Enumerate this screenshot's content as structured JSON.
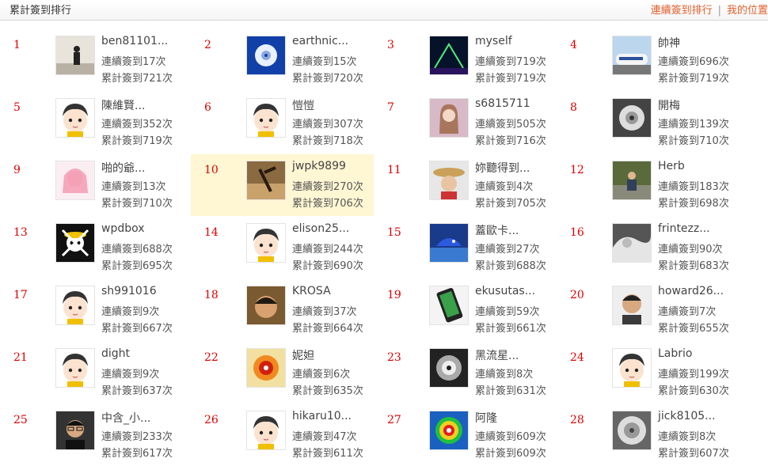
{
  "header": {
    "title": "累計簽到排行",
    "links": {
      "consecutive": "連續簽到排行",
      "separator": "|",
      "my_position": "我的位置"
    }
  },
  "rows": [
    {
      "rank": "1",
      "name": "ben81101...",
      "streak": "連續簽到17次",
      "total": "累計簽到721次",
      "avatar_icon": "silhouette-icon",
      "highlight": false
    },
    {
      "rank": "2",
      "name": "earthnic...",
      "streak": "連續簽到15次",
      "total": "累計簽到720次",
      "avatar_icon": "typhoon-satellite-icon",
      "highlight": false
    },
    {
      "rank": "3",
      "name": "myself",
      "streak": "連續簽到719次",
      "total": "累計簽到719次",
      "avatar_icon": "night-bridge-icon",
      "highlight": false
    },
    {
      "rank": "4",
      "name": "帥神",
      "streak": "連續簽到696次",
      "total": "累計簽到719次",
      "avatar_icon": "train-icon",
      "highlight": false
    },
    {
      "rank": "5",
      "name": "陳維賢...",
      "streak": "連續簽到352次",
      "total": "累計簽到719次",
      "avatar_icon": "default-avatar-icon",
      "highlight": false
    },
    {
      "rank": "6",
      "name": "愷愷",
      "streak": "連續簽到307次",
      "total": "累計簽到718次",
      "avatar_icon": "default-avatar-icon",
      "highlight": false
    },
    {
      "rank": "7",
      "name": "s6815711",
      "streak": "連續簽到505次",
      "total": "累計簽到716次",
      "avatar_icon": "portrait-woman-icon",
      "highlight": false
    },
    {
      "rank": "8",
      "name": "開梅",
      "streak": "連續簽到139次",
      "total": "累計簽到710次",
      "avatar_icon": "typhoon-gray-icon",
      "highlight": false
    },
    {
      "rank": "9",
      "name": "啪的爺...",
      "streak": "連續簽到13次",
      "total": "累計簽到710次",
      "avatar_icon": "anime-girl-icon",
      "highlight": false
    },
    {
      "rank": "10",
      "name": "jwpk9899",
      "streak": "連續簽到270次",
      "total": "累計簽到706次",
      "avatar_icon": "warrior-art-icon",
      "highlight": true
    },
    {
      "rank": "11",
      "name": "妳聽得到...",
      "streak": "連續簽到4次",
      "total": "累計簽到705次",
      "avatar_icon": "straw-hat-icon",
      "highlight": false
    },
    {
      "rank": "12",
      "name": "Herb",
      "streak": "連續簽到183次",
      "total": "累計簽到698次",
      "avatar_icon": "man-sitting-icon",
      "highlight": false
    },
    {
      "rank": "13",
      "name": "wpdbox",
      "streak": "連續簽到688次",
      "total": "累計簽到695次",
      "avatar_icon": "pirate-skull-icon",
      "highlight": false
    },
    {
      "rank": "14",
      "name": "elison25...",
      "streak": "連續簽到244次",
      "total": "累計簽到690次",
      "avatar_icon": "default-avatar-icon",
      "highlight": false
    },
    {
      "rank": "15",
      "name": "蓋歐卡...",
      "streak": "連續簽到27次",
      "total": "累計簽到688次",
      "avatar_icon": "sea-creature-icon",
      "highlight": false
    },
    {
      "rank": "16",
      "name": "frintezz...",
      "streak": "連續簽到90次",
      "total": "累計簽到683次",
      "avatar_icon": "cloud-satellite-icon",
      "highlight": false
    },
    {
      "rank": "17",
      "name": "sh991016",
      "streak": "連續簽到9次",
      "total": "累計簽到667次",
      "avatar_icon": "default-avatar-icon",
      "highlight": false
    },
    {
      "rank": "18",
      "name": "KROSA",
      "streak": "連續簽到37次",
      "total": "累計簽到664次",
      "avatar_icon": "boy-face-icon",
      "highlight": false
    },
    {
      "rank": "19",
      "name": "ekusutas...",
      "streak": "連續簽到59次",
      "total": "累計簽到661次",
      "avatar_icon": "smartphone-icon",
      "highlight": false
    },
    {
      "rank": "20",
      "name": "howard26...",
      "streak": "連續簽到7次",
      "total": "累計簽到655次",
      "avatar_icon": "man-portrait-icon",
      "highlight": false
    },
    {
      "rank": "21",
      "name": "dight",
      "streak": "連續簽到9次",
      "total": "累計簽到637次",
      "avatar_icon": "default-avatar-icon",
      "highlight": false
    },
    {
      "rank": "22",
      "name": "妮妲",
      "streak": "連續簽到6次",
      "total": "累計簽到635次",
      "avatar_icon": "typhoon-heatmap-icon",
      "highlight": false
    },
    {
      "rank": "23",
      "name": "黑流星...",
      "streak": "連續簽到8次",
      "total": "累計簽到631次",
      "avatar_icon": "typhoon-bw-icon",
      "highlight": false
    },
    {
      "rank": "24",
      "name": "Labrio",
      "streak": "連續簽到199次",
      "total": "累計簽到630次",
      "avatar_icon": "default-avatar-icon",
      "highlight": false
    },
    {
      "rank": "25",
      "name": "中含_小...",
      "streak": "連續簽到233次",
      "total": "累計簽到617次",
      "avatar_icon": "glasses-boy-icon",
      "highlight": false
    },
    {
      "rank": "26",
      "name": "hikaru10...",
      "streak": "連續簽到47次",
      "total": "累計簽到611次",
      "avatar_icon": "default-avatar-icon",
      "highlight": false
    },
    {
      "rank": "27",
      "name": "阿隆",
      "streak": "連續簽到609次",
      "total": "累計簽到609次",
      "avatar_icon": "radar-storm-icon",
      "highlight": false
    },
    {
      "rank": "28",
      "name": "jick8105...",
      "streak": "連續簽到8次",
      "total": "累計簽到607次",
      "avatar_icon": "hurricane-icon",
      "highlight": false
    }
  ]
}
